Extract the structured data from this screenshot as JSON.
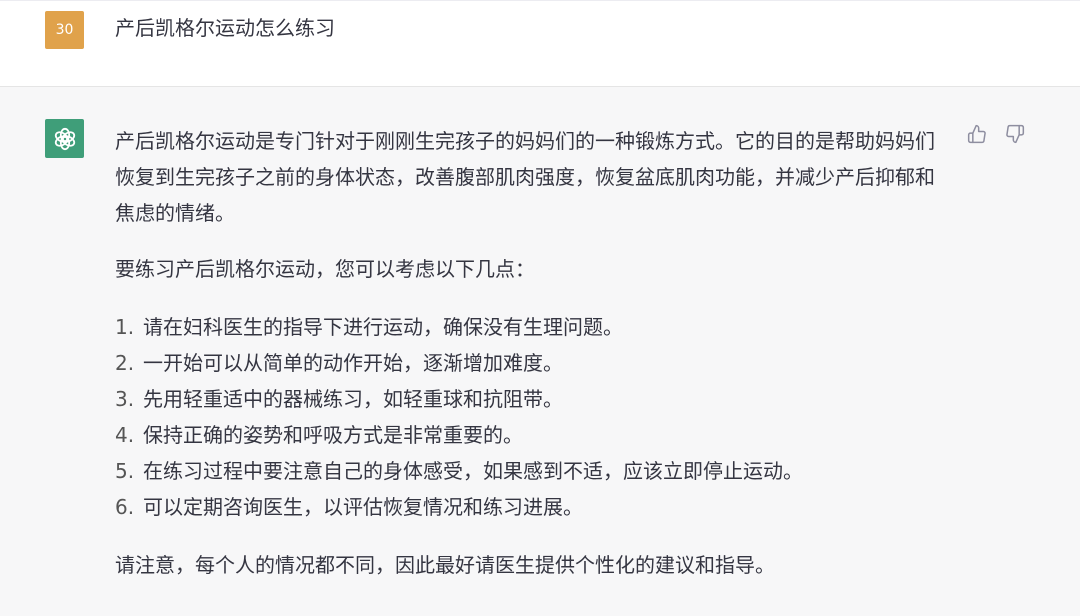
{
  "user_message": {
    "avatar_label": "30",
    "text": "产后凯格尔运动怎么练习"
  },
  "assistant_message": {
    "intro": "产后凯格尔运动是专门针对于刚刚生完孩子的妈妈们的一种锻炼方式。它的目的是帮助妈妈们恢复到生完孩子之前的身体状态，改善腹部肌肉强度，恢复盆底肌肉功能，并减少产后抑郁和焦虑的情绪。",
    "lead": "要练习产后凯格尔运动，您可以考虑以下几点：",
    "steps": [
      {
        "num": "1.",
        "text": "请在妇科医生的指导下进行运动，确保没有生理问题。"
      },
      {
        "num": "2.",
        "text": "一开始可以从简单的动作开始，逐渐增加难度。"
      },
      {
        "num": "3.",
        "text": "先用轻重适中的器械练习，如轻重球和抗阻带。"
      },
      {
        "num": "4.",
        "text": "保持正确的姿势和呼吸方式是非常重要的。"
      },
      {
        "num": "5.",
        "text": "在练习过程中要注意自己的身体感受，如果感到不适，应该立即停止运动。"
      },
      {
        "num": "6.",
        "text": "可以定期咨询医生，以评估恢复情况和练习进展。"
      }
    ],
    "note": "请注意，每个人的情况都不同，因此最好请医生提供个性化的建议和指导。"
  },
  "icons": {
    "assistant_avatar": "openai-logo-icon",
    "thumbs_up": "thumbs-up-icon",
    "thumbs_down": "thumbs-down-icon"
  },
  "colors": {
    "user_avatar_bg": "#e0a24b",
    "assistant_avatar_bg": "#3f9e79",
    "assistant_row_bg": "#f7f7f8"
  }
}
